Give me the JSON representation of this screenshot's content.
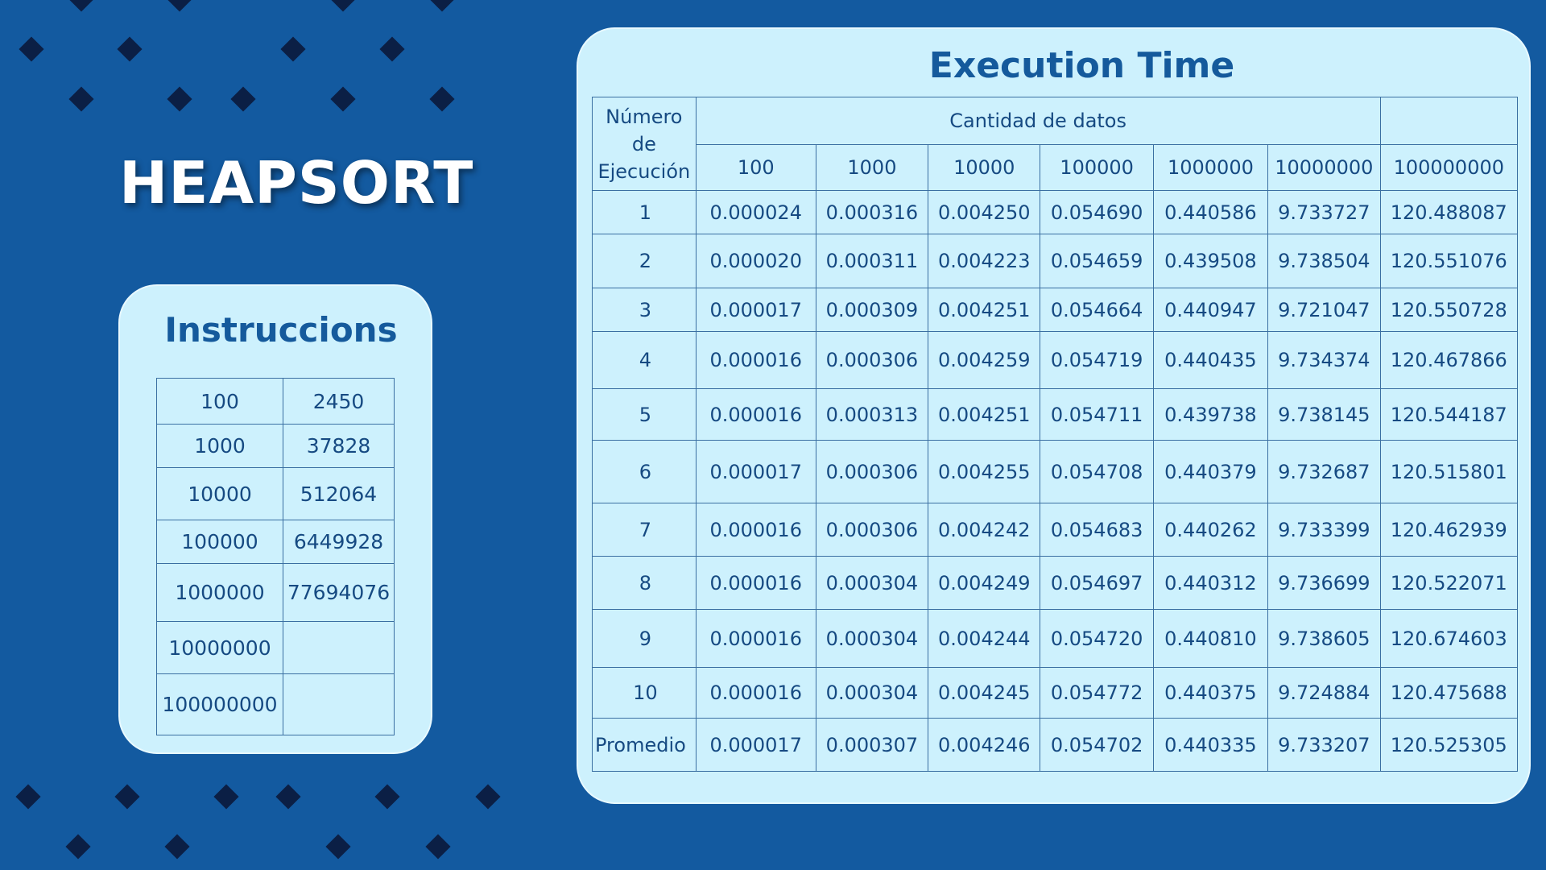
{
  "title": "HEAPSORT",
  "colors": {
    "background": "#135aa0",
    "card": "#cdf1fd",
    "title_text": "#155a9c",
    "cell_text": "#164a82",
    "diamond": "#0b1f45"
  },
  "instructions": {
    "title": "Instruccions",
    "rows": [
      [
        "100",
        "2450"
      ],
      [
        "1000",
        "37828"
      ],
      [
        "10000",
        "512064"
      ],
      [
        "100000",
        "6449928"
      ],
      [
        "1000000",
        "77694076"
      ],
      [
        "10000000",
        ""
      ],
      [
        "100000000",
        ""
      ]
    ]
  },
  "execution": {
    "title": "Execution Time",
    "row_header": "Número de Ejecución",
    "group_header": "Cantidad de datos",
    "columns": [
      "100",
      "1000",
      "10000",
      "100000",
      "1000000",
      "10000000",
      "100000000"
    ],
    "rows": [
      [
        "1",
        "0.000024",
        "0.000316",
        "0.004250",
        "0.054690",
        "0.440586",
        "9.733727",
        "120.488087"
      ],
      [
        "2",
        "0.000020",
        "0.000311",
        "0.004223",
        "0.054659",
        "0.439508",
        "9.738504",
        "120.551076"
      ],
      [
        "3",
        "0.000017",
        "0.000309",
        "0.004251",
        "0.054664",
        "0.440947",
        "9.721047",
        "120.550728"
      ],
      [
        "4",
        "0.000016",
        "0.000306",
        "0.004259",
        "0.054719",
        "0.440435",
        "9.734374",
        "120.467866"
      ],
      [
        "5",
        "0.000016",
        "0.000313",
        "0.004251",
        "0.054711",
        "0.439738",
        "9.738145",
        "120.544187"
      ],
      [
        "6",
        "0.000017",
        "0.000306",
        "0.004255",
        "0.054708",
        "0.440379",
        "9.732687",
        "120.515801"
      ],
      [
        "7",
        "0.000016",
        "0.000306",
        "0.004242",
        "0.054683",
        "0.440262",
        "9.733399",
        "120.462939"
      ],
      [
        "8",
        "0.000016",
        "0.000304",
        "0.004249",
        "0.054697",
        "0.440312",
        "9.736699",
        "120.522071"
      ],
      [
        "9",
        "0.000016",
        "0.000304",
        "0.004244",
        "0.054720",
        "0.440810",
        "9.738605",
        "120.674603"
      ],
      [
        "10",
        "0.000016",
        "0.000304",
        "0.004245",
        "0.054772",
        "0.440375",
        "9.724884",
        "120.475688"
      ],
      [
        "Promedio",
        "0.000017",
        "0.000307",
        "0.004246",
        "0.054702",
        "0.440335",
        "9.733207",
        "120.525305"
      ]
    ]
  }
}
